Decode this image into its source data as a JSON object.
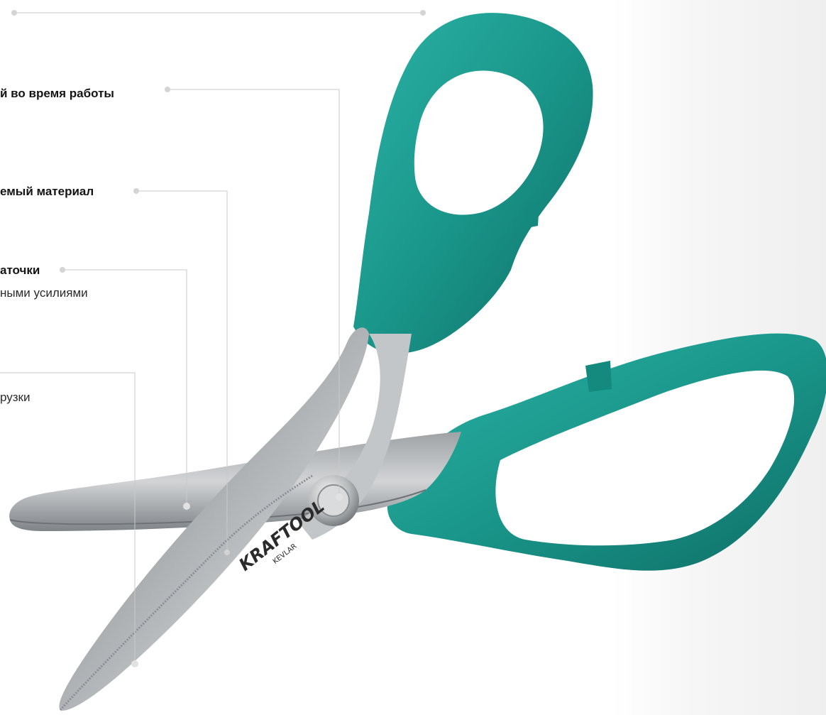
{
  "callouts": [
    {
      "id": "top",
      "title": "",
      "desc": ""
    },
    {
      "id": "ergonomic",
      "title": "й во время работы",
      "desc": ""
    },
    {
      "id": "material",
      "title": "емый материал",
      "desc": ""
    },
    {
      "id": "sharpening",
      "title": "аточки",
      "desc": "ными усилиями"
    },
    {
      "id": "load",
      "title": "",
      "desc": "рузки"
    }
  ],
  "product": {
    "brand_logo": "KRAFTOOL",
    "brand_sub": "KEVLAR",
    "handle_color": "#1e9b8f",
    "handle_dark": "#0f6f67",
    "blade_color": "#b9bcbf"
  },
  "colors": {
    "leader_line": "#c9c9c9",
    "dot": "#d4d4d4",
    "background_right": "#efefef"
  }
}
